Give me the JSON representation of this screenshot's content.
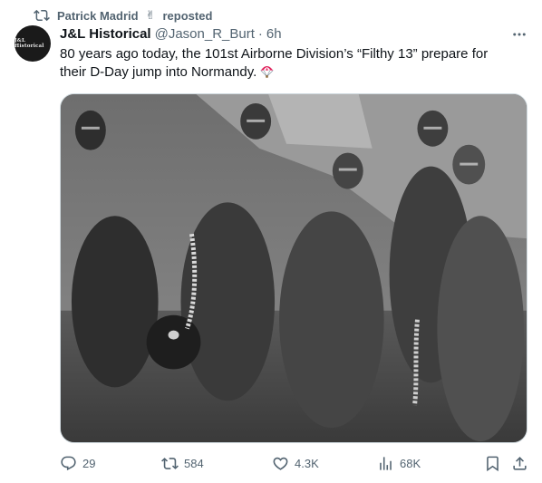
{
  "repost": {
    "icon": "repost-icon",
    "user": "Patrick Madrid",
    "emoji": "✌",
    "verb": "reposted"
  },
  "author": {
    "avatar_text": "J&L Historical",
    "display_name": "J&L Historical",
    "handle": "@Jason_R_Burt",
    "separator": "·",
    "time": "6h"
  },
  "tweet": {
    "line1": "80 years ago today, the 101st Airborne Division’s “Filthy 13” prepare for",
    "line2": "their D-Day jump into Normandy.",
    "emoji_icon": "parachute-icon"
  },
  "media": {
    "type": "black-and-white photograph"
  },
  "actions": {
    "replies": "29",
    "reposts": "584",
    "likes": "4.3K",
    "views": "68K",
    "icons": [
      "reply-icon",
      "repost-icon",
      "like-icon",
      "views-icon",
      "bookmark-icon",
      "share-icon"
    ]
  },
  "colors": {
    "text_primary": "#0f1419",
    "text_secondary": "#536471",
    "border": "#cfd9de",
    "background": "#ffffff"
  }
}
